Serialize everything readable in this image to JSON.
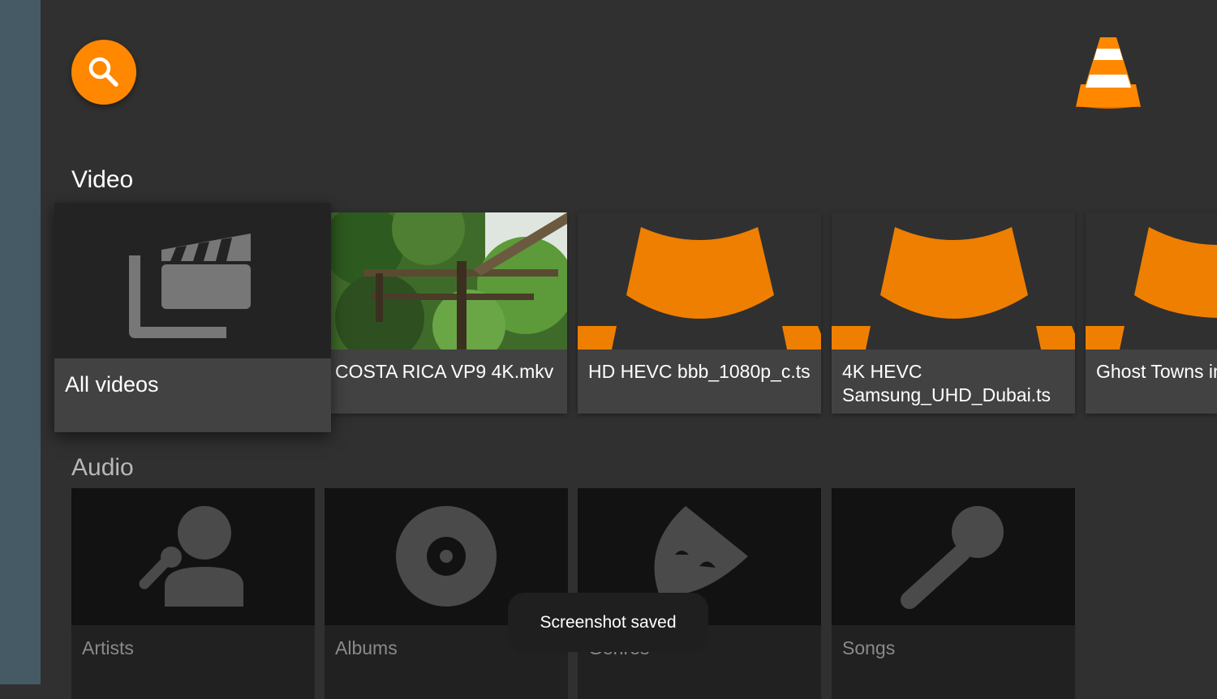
{
  "sections": {
    "video_title": "Video",
    "audio_title": "Audio"
  },
  "video": {
    "all_videos": "All videos",
    "items": [
      {
        "label": "COSTA RICA VP9 4K.mkv",
        "icon": "forest-thumbnail"
      },
      {
        "label": "HD HEVC bbb_1080p_c.ts",
        "icon": "vlc-cone-thumbnail"
      },
      {
        "label": "4K HEVC\nSamsung_UHD_Dubai.ts",
        "icon": "vlc-cone-thumbnail"
      },
      {
        "label": "Ghost Towns in",
        "icon": "vlc-cone-thumbnail"
      }
    ]
  },
  "audio": {
    "items": [
      {
        "label": "Artists",
        "icon": "artist-icon"
      },
      {
        "label": "Albums",
        "icon": "album-icon"
      },
      {
        "label": "Genres",
        "icon": "genre-mask-icon"
      },
      {
        "label": "Songs",
        "icon": "microphone-icon"
      }
    ]
  },
  "toast": {
    "message": "Screenshot saved"
  },
  "colors": {
    "accent": "#ff8800",
    "background": "#303030",
    "side_rail": "#455a64"
  }
}
